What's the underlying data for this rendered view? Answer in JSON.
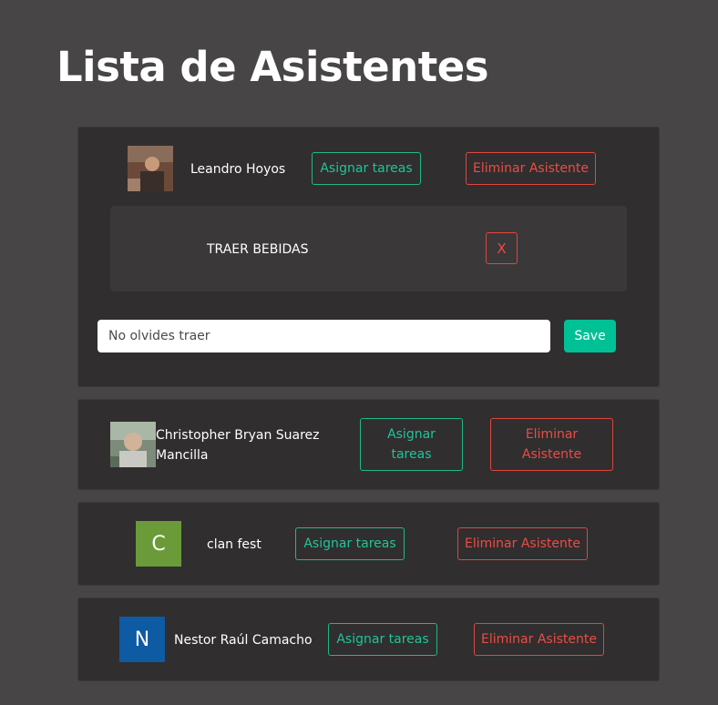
{
  "page": {
    "title": "Lista de Asistentes"
  },
  "colors": {
    "background": "#474546",
    "card": "#302e2f",
    "assign": "#1fc596",
    "delete": "#ec4c44",
    "save": "#00c095",
    "avatar_c": "#6a9b38",
    "avatar_n": "#0e5aa3"
  },
  "attendees": [
    {
      "name": "Leandro Hoyos",
      "avatar": "photo",
      "assign_label": "Asignar tareas",
      "delete_label": "Eliminar Asistente",
      "tasks": [
        {
          "label": "TRAER BEBIDAS",
          "remove_label": "X"
        }
      ],
      "task_input": {
        "placeholder": "No olvides traer",
        "value": ""
      },
      "save_label": "Save"
    },
    {
      "name": "Christopher Bryan Suarez Mancilla",
      "avatar": "photo",
      "assign_label": "Asignar tareas",
      "delete_label": "Eliminar Asistente"
    },
    {
      "name": "clan fest",
      "avatar": "C",
      "assign_label": "Asignar tareas",
      "delete_label": "Eliminar Asistente"
    },
    {
      "name": "Nestor Raúl Camacho",
      "avatar": "N",
      "assign_label": "Asignar tareas",
      "delete_label": "Eliminar Asistente"
    }
  ]
}
